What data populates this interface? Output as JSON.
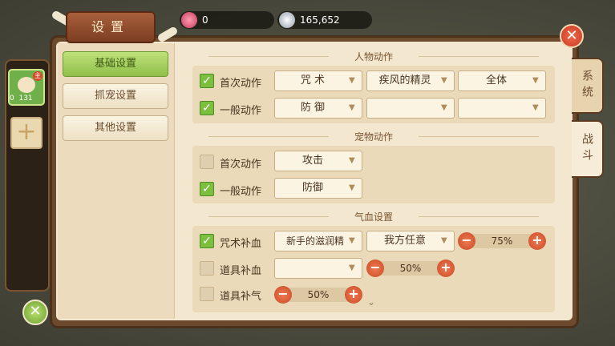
{
  "header": {
    "title": "设置"
  },
  "currency": [
    {
      "icon": "gem-icon",
      "value": "0"
    },
    {
      "icon": "silver-coin-icon",
      "value": "165,652"
    }
  ],
  "left_menu": [
    {
      "label": "基础设置",
      "active": true
    },
    {
      "label": "抓宠设置",
      "active": false
    },
    {
      "label": "其他设置",
      "active": false
    }
  ],
  "side_tabs": [
    {
      "label": "系统",
      "active": false
    },
    {
      "label": "战斗",
      "active": true
    }
  ],
  "pet": {
    "badge": "主",
    "level": "0",
    "hp": "131"
  },
  "sections": {
    "character": {
      "title": "人物动作",
      "rows": [
        {
          "label": "首次动作",
          "checked": true,
          "d1": "咒 术",
          "d2": "疾风的精灵",
          "d3": "全体"
        },
        {
          "label": "一般动作",
          "checked": true,
          "d1": "防 御",
          "d2": "",
          "d3": ""
        }
      ]
    },
    "pet": {
      "title": "宠物动作",
      "rows": [
        {
          "label": "首次动作",
          "checked": false,
          "d1": "攻击"
        },
        {
          "label": "一般动作",
          "checked": true,
          "d1": "防御"
        }
      ]
    },
    "hp": {
      "title": "气血设置",
      "rows": [
        {
          "label": "咒术补血",
          "checked": true,
          "d1": "新手的滋润精",
          "d2": "我方任意",
          "percent": "75%"
        },
        {
          "label": "道具补血",
          "checked": false,
          "d1": "",
          "percent": "50%"
        },
        {
          "label": "道具补气",
          "checked": false,
          "percent": "50%"
        }
      ]
    }
  },
  "colors": {
    "accent_green": "#7cbf3e",
    "frame_brown": "#6b4a2d",
    "stepper_red": "#c84a26"
  }
}
